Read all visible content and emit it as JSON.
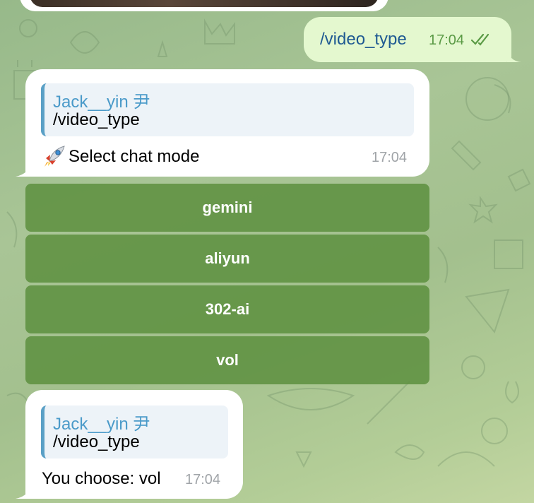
{
  "outgoing": {
    "text": "/video_type",
    "time": "17:04"
  },
  "bot_message_1": {
    "reply_name": "Jack__yin 尹",
    "reply_text": "/video_type",
    "icon": "rocket-icon",
    "text": "Select chat mode",
    "time": "17:04"
  },
  "keyboard": {
    "buttons": [
      {
        "label": "gemini"
      },
      {
        "label": "aliyun"
      },
      {
        "label": "302-ai"
      },
      {
        "label": "vol"
      }
    ]
  },
  "bot_message_2": {
    "reply_name": "Jack__yin 尹",
    "reply_text": "/video_type",
    "text": "You choose: vol",
    "time": "17:04"
  },
  "colors": {
    "keyboard_button": "#5f9141",
    "outgoing_bubble": "#e4f8cf",
    "reply_accent": "#4a9ac9",
    "link_text": "#1f5a92"
  }
}
